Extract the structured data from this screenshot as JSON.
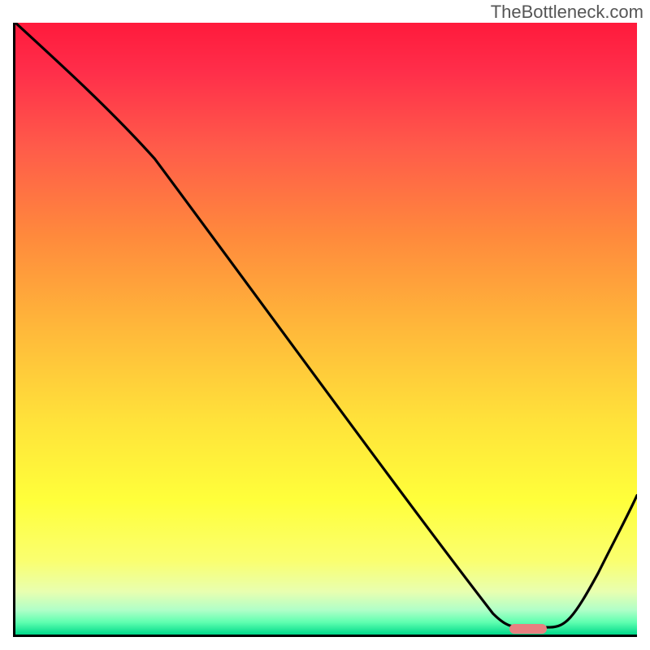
{
  "watermark": "TheBottleneck.com",
  "chart_data": {
    "type": "line",
    "title": "",
    "xlabel": "",
    "ylabel": "",
    "xlim": [
      0,
      100
    ],
    "ylim": [
      0,
      100
    ],
    "x": [
      0,
      22,
      80,
      86,
      100
    ],
    "values": [
      100,
      78,
      2,
      2,
      24
    ],
    "marker_position_x": 82,
    "marker_position_y": 2,
    "background_gradient": {
      "top": "#ff1a3c",
      "upper_mid": "#ffb83a",
      "mid": "#ffff3a",
      "lower": "#00d98a"
    }
  }
}
